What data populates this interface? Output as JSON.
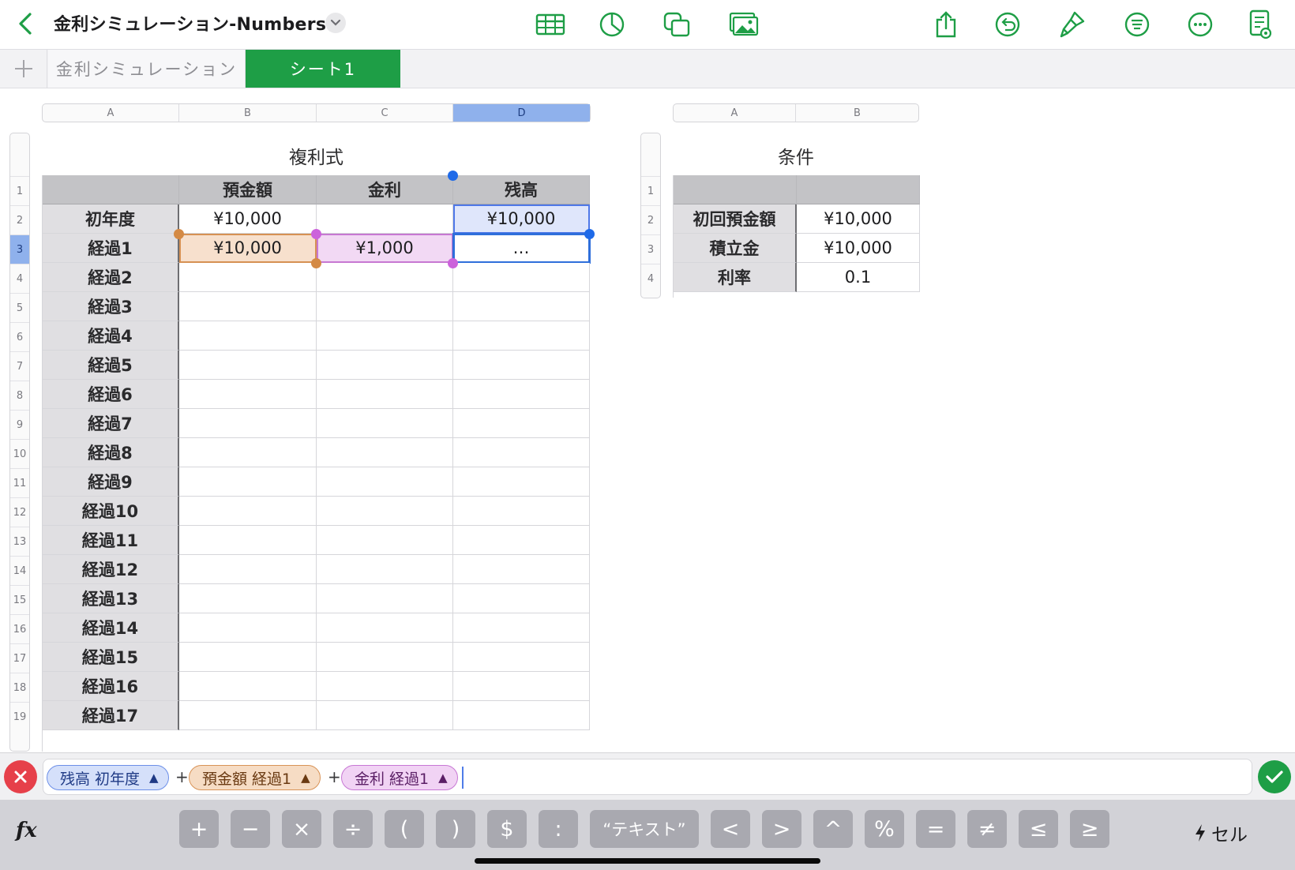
{
  "document": {
    "title": "金利シミュレーション-Numbers"
  },
  "toolbar": {
    "icons": [
      "table-icon",
      "chart-icon",
      "shapes-icon",
      "media-icon",
      "share-icon",
      "undo-icon",
      "format-brush-icon",
      "list-icon",
      "more-icon",
      "reading-view-icon"
    ]
  },
  "tabs": [
    {
      "label": "金利シミュレーション",
      "active": false
    },
    {
      "label": "シート1",
      "active": true
    }
  ],
  "table_main": {
    "title": "複利式",
    "columns": [
      "A",
      "B",
      "C",
      "D"
    ],
    "header": [
      "",
      "預金額",
      "金利",
      "残高"
    ],
    "row_numbers": [
      "1",
      "2",
      "3",
      "4",
      "5",
      "6",
      "7",
      "8",
      "9",
      "10",
      "11",
      "12",
      "13",
      "14",
      "15",
      "16",
      "17",
      "18",
      "19"
    ],
    "rows": [
      [
        "初年度",
        "¥10,000",
        "",
        "¥10,000"
      ],
      [
        "経過1",
        "¥10,000",
        "¥1,000",
        "…"
      ],
      [
        "経過2",
        "",
        "",
        ""
      ],
      [
        "経過3",
        "",
        "",
        ""
      ],
      [
        "経過4",
        "",
        "",
        ""
      ],
      [
        "経過5",
        "",
        "",
        ""
      ],
      [
        "経過6",
        "",
        "",
        ""
      ],
      [
        "経過7",
        "",
        "",
        ""
      ],
      [
        "経過8",
        "",
        "",
        ""
      ],
      [
        "経過9",
        "",
        "",
        ""
      ],
      [
        "経過10",
        "",
        "",
        ""
      ],
      [
        "経過11",
        "",
        "",
        ""
      ],
      [
        "経過12",
        "",
        "",
        ""
      ],
      [
        "経過13",
        "",
        "",
        ""
      ],
      [
        "経過14",
        "",
        "",
        ""
      ],
      [
        "経過15",
        "",
        "",
        ""
      ],
      [
        "経過16",
        "",
        "",
        ""
      ],
      [
        "経過17",
        "",
        "",
        ""
      ]
    ],
    "selected_column": "D",
    "selected_row": "3"
  },
  "table_conditions": {
    "title": "条件",
    "columns": [
      "A",
      "B"
    ],
    "row_numbers": [
      "1",
      "2",
      "3",
      "4"
    ],
    "rows": [
      [
        "初回預金額",
        "¥10,000"
      ],
      [
        "積立金",
        "¥10,000"
      ],
      [
        "利率",
        "0.1"
      ]
    ]
  },
  "formula": {
    "tokens": [
      {
        "label": "残高 初年度",
        "color": "#d5e0fa"
      },
      {
        "label": "預金額 経過1",
        "color": "#f6dcc4"
      },
      {
        "label": "金利 経過1",
        "color": "#f1d3f4"
      }
    ],
    "operators": [
      "+",
      "+"
    ]
  },
  "keyboard": {
    "fx_label": "fx",
    "keys": [
      "+",
      "−",
      "×",
      "÷",
      "(",
      ")",
      "$",
      ":",
      "“テキスト”",
      "<",
      ">",
      "^",
      "%",
      "=",
      "≠",
      "≤",
      "≥"
    ],
    "mode_label": "セル"
  },
  "colors": {
    "accent_green": "#1e9e46",
    "selection_blue": "#2f6fdb",
    "cancel_red": "#e6404a"
  }
}
